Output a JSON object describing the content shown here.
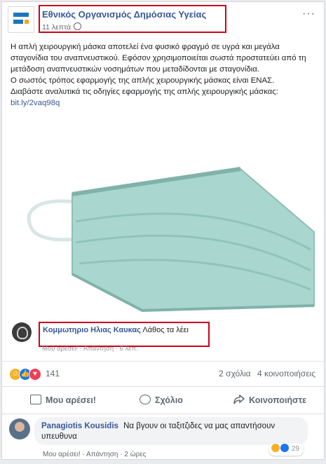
{
  "post": {
    "page_name": "Εθνικός Οργανισμός Δημόσιας Υγείας",
    "timestamp": "11 λεπτά",
    "more_label": "···",
    "text_lines": [
      "Η απλή χειρουργική μάσκα αποτελεί ένα φυσικό φραγμό σε υγρά και μεγάλα σταγονίδια του αναπνευστικού. Εφόσον χρησιμοποιείται σωστά προστατεύει από τη μετάδοση αναπνευστικών νοσημάτων που μεταδίδονται με σταγονίδια.",
      "Ο σωστός τρόπος εφαρμογής της απλής χειρουργικής μάσκας είναι ΕΝΑΣ.",
      "Διαβάστε αναλυτικά τις οδηγίες εφαρμογής της απλής χειρουργικής μάσκας:"
    ],
    "link": "bit.ly/2vaq98q"
  },
  "comment_overlay": {
    "name": "Κομμωτηριο Ηλιας Καυκας",
    "text": "Λάθος τα λέει",
    "actions": "Μου αρέσει! · Απάντηση · 6 λεπ."
  },
  "stats": {
    "reaction_count": "141",
    "comments": "2 σχόλια",
    "shares": "4 κοινοποιήσεις"
  },
  "actions": {
    "like": "Μου αρέσει!",
    "comment": "Σχόλιο",
    "share": "Κοινοποιήστε"
  },
  "comment2": {
    "name": "Panagiotis Kousidis",
    "text": "Να βγουν οι ταξιτζιδες να μας απαντήσουν υπευθυνα",
    "actions": "Μου αρέσει! · Απάντηση · 2 ώρες",
    "reaction_count": "29"
  },
  "colors": {
    "highlight_box": "#d0021b",
    "link": "#385898",
    "mask": "#a9d6cf"
  }
}
